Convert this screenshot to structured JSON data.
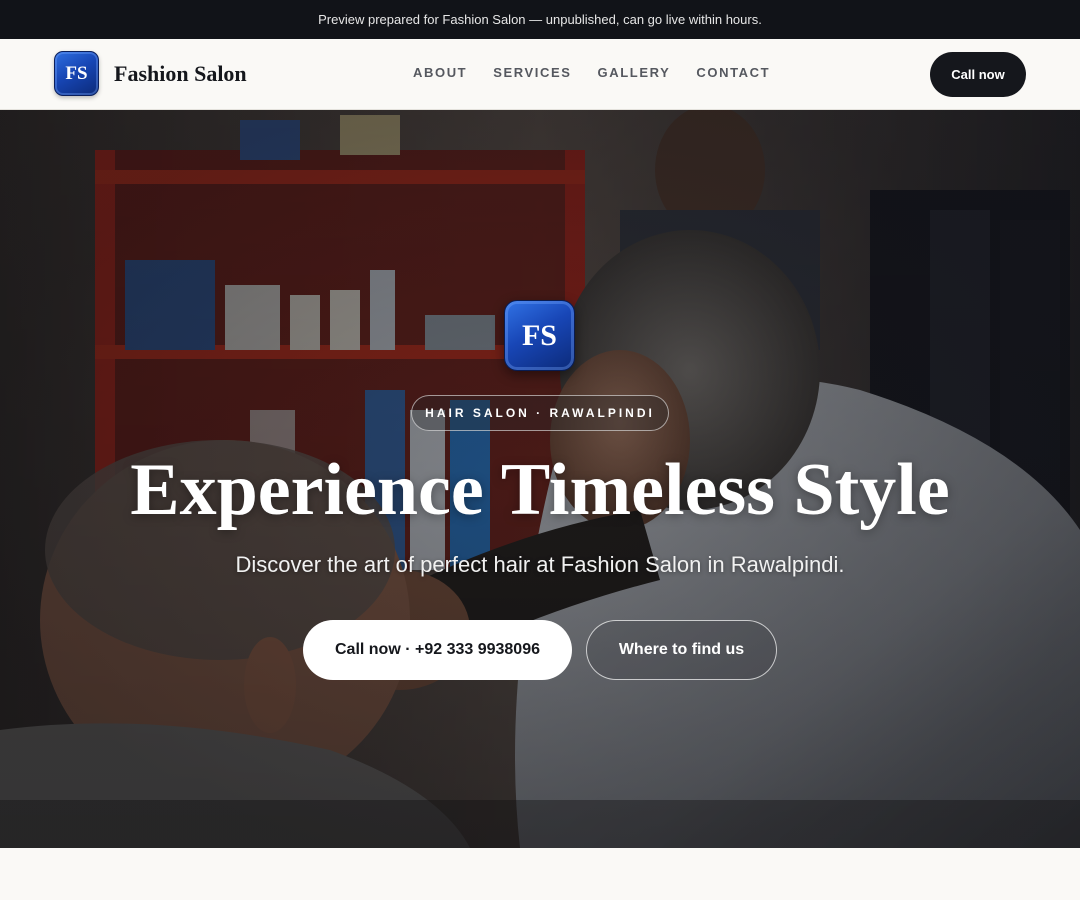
{
  "preview_banner": {
    "text": "Preview prepared for Fashion Salon — unpublished, can go live within hours."
  },
  "nav": {
    "logo_initials": "FS",
    "brand_name": "Fashion Salon",
    "links": [
      "ABOUT",
      "SERVICES",
      "GALLERY",
      "CONTACT"
    ],
    "cta_label": "Call now"
  },
  "hero": {
    "logo_initials": "FS",
    "tagline": "HAIR SALON · RAWALPINDI",
    "title": "Experience Timeless Style",
    "subtitle": "Discover the art of perfect hair at Fashion Salon in Rawalpindi.",
    "primary_button": "Call now · +92 333 9938096",
    "secondary_button": "Where to find us",
    "background_image": "barber-cutting-client-hair-photo"
  },
  "colors": {
    "banner_bg": "#111318",
    "page_bg": "#faf9f6",
    "brand_blue": "#1746b5",
    "dark_button": "#15171c"
  }
}
